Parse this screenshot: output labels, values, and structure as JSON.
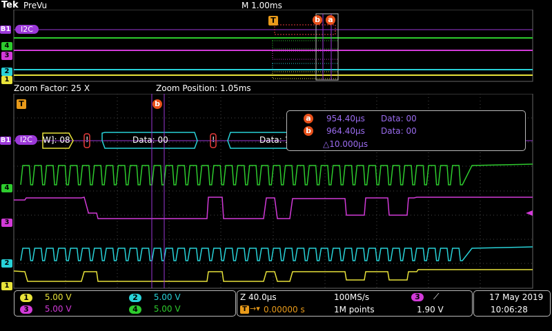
{
  "header": {
    "brand": "Tek",
    "mode": "PreVu",
    "timebase": "M 1.00ms"
  },
  "overview": {
    "bus_label": "I2C",
    "bus_channel": "B1",
    "trigger_marker": "T",
    "cursor_a": "a",
    "cursor_b": "b"
  },
  "zoom": {
    "factor_text": "Zoom Factor: 25 X",
    "position_text": "Zoom Position: 1.05ms",
    "bus_label": "I2C",
    "packet1": "W]: 08",
    "packet2": "Data: 00",
    "packet3": "Data: 1",
    "error_mark": "!"
  },
  "cursor_readout": {
    "a_label": "a",
    "a_time": "954.40µs",
    "a_data": "Data: 00",
    "b_label": "b",
    "b_time": "964.40µs",
    "b_data": "Data: 00",
    "delta": "△10.000µs"
  },
  "channels": [
    {
      "num": "1",
      "color": "#e8e33a",
      "scale": "5.00 V"
    },
    {
      "num": "2",
      "color": "#28d2d8",
      "scale": "5.00 V"
    },
    {
      "num": "3",
      "color": "#d23ad8",
      "scale": "5.00 V"
    },
    {
      "num": "4",
      "color": "#2ecc2e",
      "scale": "5.00 V"
    }
  ],
  "acquisition": {
    "zoom_time": "Z 40.0µs",
    "sample_rate": "100MS/s",
    "trigger_delay": "0.00000 s",
    "record_length": "1M points",
    "trigger_source": "3",
    "trigger_level": "1.90 V"
  },
  "datetime": {
    "date": "17 May 2019",
    "time": "10:06:28"
  },
  "colors": {
    "bus": "#9b38d8",
    "cursor_a": "#e8501a",
    "trigger": "#e89a1a",
    "grid": "#4a4a4a"
  }
}
